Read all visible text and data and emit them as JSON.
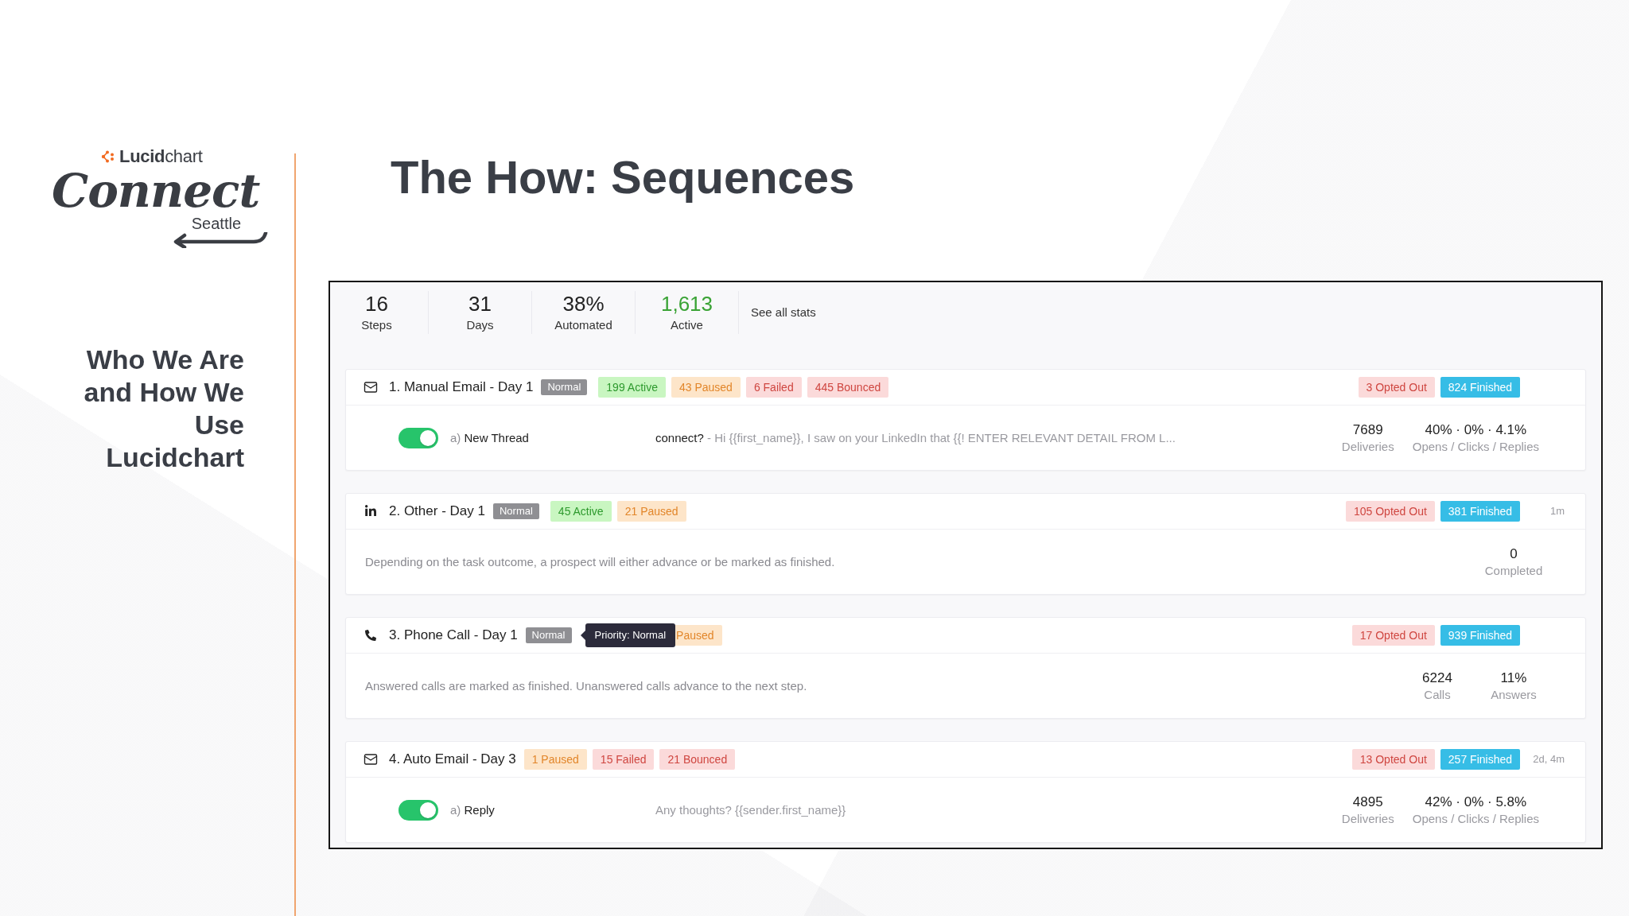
{
  "logo": {
    "brand": "**Lucid**chart",
    "wordmark": "Connect",
    "city": "Seattle"
  },
  "sidebar": {
    "heading": "Who We Are and How We Use Lucidchart"
  },
  "title": "The How: Sequences",
  "stats": [
    {
      "value": "16",
      "label": "Steps",
      "color": "#222222"
    },
    {
      "value": "31",
      "label": "Days",
      "color": "#222222"
    },
    {
      "value": "38%",
      "label": "Automated",
      "color": "#222222"
    },
    {
      "value": "1,613",
      "label": "Active",
      "color": "#3aa335"
    }
  ],
  "see_all_link": "See all stats",
  "steps": [
    {
      "kind": "email",
      "title": "1. Manual Email - Day 1",
      "priority": "Normal",
      "badges": [
        {
          "kind": "active",
          "label": "199 Active"
        },
        {
          "kind": "paused",
          "label": "43 Paused"
        },
        {
          "kind": "failed",
          "label": "6 Failed"
        },
        {
          "kind": "bounced",
          "label": "445 Bounced"
        }
      ],
      "outcomes": [
        {
          "kind": "opted_out",
          "label": "3 Opted Out"
        },
        {
          "kind": "finished",
          "label": "824 Finished"
        }
      ],
      "body": {
        "kind": "message",
        "enabled": true,
        "variant": {
          "letter": "a)",
          "name": "New Thread"
        },
        "subject": "connect?",
        "preview": "- Hi {{first_name}}, I saw on your LinkedIn that {{! ENTER RELEVANT DETAIL FROM L...",
        "stats": [
          {
            "value": "7689",
            "label": "Deliveries"
          },
          {
            "value": "40% · 0% · 4.1%",
            "label": "Opens / Clicks / Replies"
          }
        ]
      }
    },
    {
      "kind": "linkedin",
      "title": "2. Other - Day 1",
      "priority": "Normal",
      "badges": [
        {
          "kind": "active",
          "label": "45 Active"
        },
        {
          "kind": "paused",
          "label": "21 Paused"
        }
      ],
      "outcomes": [
        {
          "kind": "opted_out",
          "label": "105 Opted Out"
        },
        {
          "kind": "finished",
          "label": "381 Finished"
        }
      ],
      "time": "1m",
      "body": {
        "kind": "note",
        "description": "Depending on the task outcome, a prospect will either advance or be marked as finished.",
        "stats": [
          {
            "value": "0",
            "label": "Completed"
          }
        ]
      }
    },
    {
      "kind": "phone",
      "title": "3. Phone Call - Day 1",
      "priority": "Normal",
      "tooltip": "Priority: Normal",
      "badges": [
        {
          "kind": "paused",
          "label": "Paused"
        }
      ],
      "outcomes": [
        {
          "kind": "opted_out",
          "label": "17 Opted Out"
        },
        {
          "kind": "finished",
          "label": "939 Finished"
        }
      ],
      "body": {
        "kind": "note",
        "description": "Answered calls are marked as finished. Unanswered calls advance to the next step.",
        "stats": [
          {
            "value": "6224",
            "label": "Calls"
          },
          {
            "value": "11%",
            "label": "Answers"
          }
        ]
      }
    },
    {
      "kind": "email",
      "title": "4. Auto Email - Day 3",
      "badges": [
        {
          "kind": "paused",
          "label": "1 Paused"
        },
        {
          "kind": "failed",
          "label": "15 Failed"
        },
        {
          "kind": "bounced",
          "label": "21 Bounced"
        }
      ],
      "outcomes": [
        {
          "kind": "opted_out",
          "label": "13 Opted Out"
        },
        {
          "kind": "finished",
          "label": "257 Finished"
        }
      ],
      "time": "2d, 4m",
      "body": {
        "kind": "message",
        "enabled": true,
        "variant": {
          "letter": "a)",
          "name": "Reply"
        },
        "preview": "Any thoughts? {{sender.first_name}}",
        "stats": [
          {
            "value": "4895",
            "label": "Deliveries"
          },
          {
            "value": "42% · 0% · 5.8%",
            "label": "Opens / Clicks / Replies"
          }
        ]
      }
    }
  ]
}
